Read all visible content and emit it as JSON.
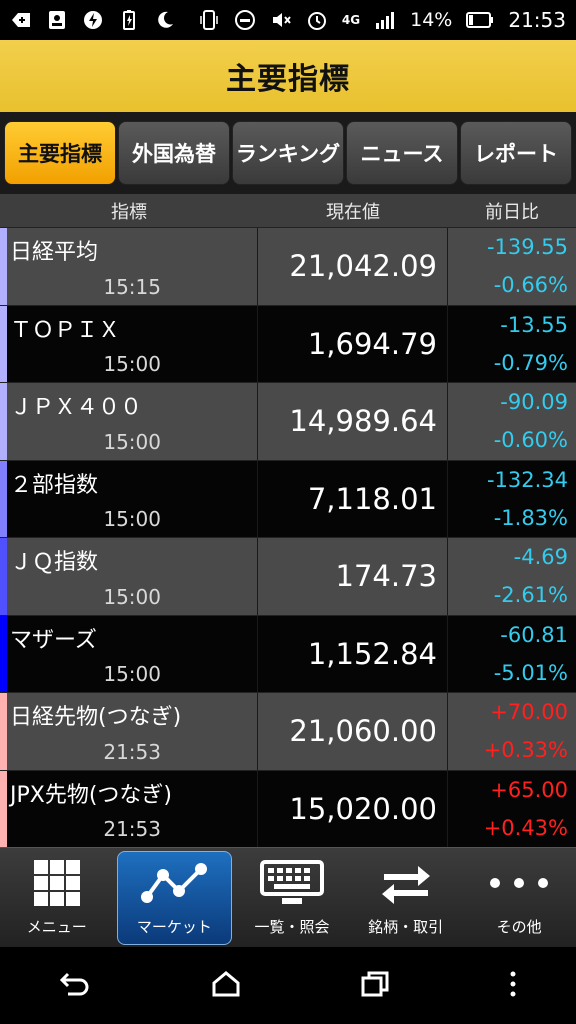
{
  "status": {
    "battery_pct": "14%",
    "time": "21:53",
    "network": "4G"
  },
  "header": {
    "title": "主要指標"
  },
  "tabs": [
    {
      "label": "主要指標",
      "active": true
    },
    {
      "label": "外国為替",
      "active": false
    },
    {
      "label": "ランキング",
      "active": false
    },
    {
      "label": "ニュース",
      "active": false
    },
    {
      "label": "レポート",
      "active": false
    }
  ],
  "columns": {
    "name": "指標",
    "price": "現在値",
    "change": "前日比"
  },
  "rows": [
    {
      "name": "日経平均",
      "time": "15:15",
      "price": "21,042.09",
      "change": "-139.55",
      "pct": "-0.66%",
      "dir": "neg",
      "bar": "#b0b0ff"
    },
    {
      "name": "ＴＯＰＩＸ",
      "time": "15:00",
      "price": "1,694.79",
      "change": "-13.55",
      "pct": "-0.79%",
      "dir": "neg",
      "bar": "#b0b0ff"
    },
    {
      "name": "ＪＰＸ４００",
      "time": "15:00",
      "price": "14,989.64",
      "change": "-90.09",
      "pct": "-0.60%",
      "dir": "neg",
      "bar": "#b0b0ff"
    },
    {
      "name": "２部指数",
      "time": "15:00",
      "price": "7,118.01",
      "change": "-132.34",
      "pct": "-1.83%",
      "dir": "neg",
      "bar": "#8080ff"
    },
    {
      "name": "ＪＱ指数",
      "time": "15:00",
      "price": "174.73",
      "change": "-4.69",
      "pct": "-2.61%",
      "dir": "neg",
      "bar": "#5050ff"
    },
    {
      "name": "マザーズ",
      "time": "15:00",
      "price": "1,152.84",
      "change": "-60.81",
      "pct": "-5.01%",
      "dir": "neg",
      "bar": "#0000ff"
    },
    {
      "name": "日経先物(つなぎ)",
      "time": "21:53",
      "price": "21,060.00",
      "change": "+70.00",
      "pct": "+0.33%",
      "dir": "pos",
      "bar": "#ffb0b0"
    },
    {
      "name": "JPX先物(つなぎ)",
      "time": "21:53",
      "price": "15,020.00",
      "change": "+65.00",
      "pct": "+0.43%",
      "dir": "pos",
      "bar": "#ffb0b0"
    }
  ],
  "bottom_nav": [
    {
      "label": "メニュー",
      "icon": "grid-icon",
      "active": false
    },
    {
      "label": "マーケット",
      "icon": "chart-line-icon",
      "active": true
    },
    {
      "label": "一覧・照会",
      "icon": "keyboard-icon",
      "active": false
    },
    {
      "label": "銘柄・取引",
      "icon": "swap-arrows-icon",
      "active": false
    },
    {
      "label": "その他",
      "icon": "more-dots-icon",
      "active": false
    }
  ]
}
